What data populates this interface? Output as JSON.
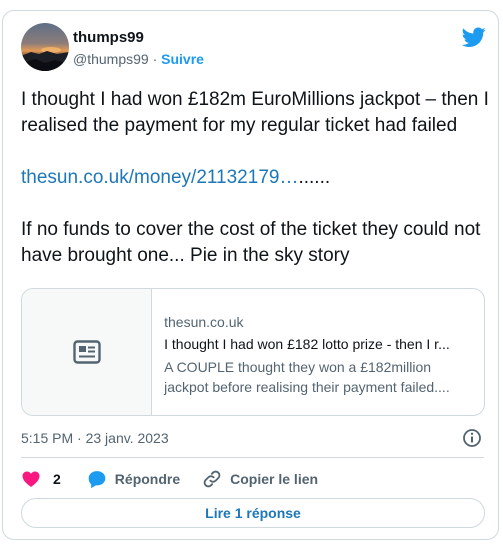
{
  "author": {
    "display_name": "thumps99",
    "handle": "@thumps99",
    "separator": "·",
    "follow_label": "Suivre"
  },
  "tweet": {
    "paragraph_1": "I thought I had won £182m EuroMillions jackpot – then I realised the payment for my regular ticket had failed",
    "link_text": "thesun.co.uk/money/21132179…",
    "link_suffix": "......",
    "paragraph_3": "If no funds to cover the cost of the ticket they could not have brought one...  Pie in the sky story"
  },
  "link_preview": {
    "domain": "thesun.co.uk",
    "title": "I thought I had won £182 lotto prize - then I r...",
    "description": "A COUPLE thought they won a £182million jackpot before realising their payment failed...."
  },
  "timestamp": "5:15 PM · 23 janv. 2023",
  "actions": {
    "like_count": "2",
    "reply_label": "Répondre",
    "copy_link_label": "Copier le lien"
  },
  "read_replies_label": "Lire 1 réponse",
  "colors": {
    "accent": "#1d9bf0",
    "link": "#1d77b8",
    "like": "#f91880",
    "border": "#cfd9de",
    "secondary_text": "#536471"
  },
  "icons": {
    "logo": "twitter-bird-icon",
    "preview": "newspaper-icon",
    "info": "info-icon",
    "like": "heart-icon",
    "reply": "speech-bubble-icon",
    "copy_link": "link-icon"
  }
}
